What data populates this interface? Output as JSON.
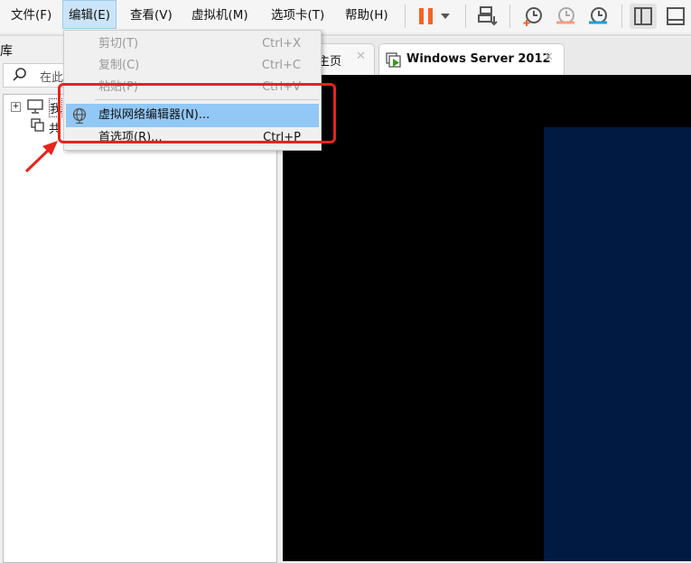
{
  "menubar": {
    "items": [
      "文件(F)",
      "编辑(E)",
      "查看(V)",
      "虚拟机(M)",
      "选项卡(T)",
      "帮助(H)"
    ]
  },
  "toolbar": {
    "icons": [
      "pause-icon",
      "dropdown-icon",
      "send-ctrl-alt-del-icon",
      "snapshot-take-icon",
      "snapshot-revert-icon",
      "snapshot-manager-icon",
      "library-view-icon",
      "thumbnail-view-icon"
    ],
    "accent": "#f26522"
  },
  "library": {
    "title": "库",
    "search_placeholder": "在此",
    "tree": [
      "我",
      "共"
    ]
  },
  "tabs": [
    {
      "label": "主页"
    },
    {
      "label": "Windows Server 2012"
    }
  ],
  "edit_menu": {
    "items": [
      {
        "label": "剪切(T)",
        "shortcut": "Ctrl+X",
        "disabled": true
      },
      {
        "label": "复制(C)",
        "shortcut": "Ctrl+C",
        "disabled": true
      },
      {
        "label": "粘贴(P)",
        "shortcut": "Ctrl+V",
        "disabled": true
      },
      {
        "label": "虚拟网络编辑器(N)...",
        "shortcut": "",
        "highlighted": true
      },
      {
        "label": "首选项(R)...",
        "shortcut": "Ctrl+P"
      }
    ]
  },
  "annotation": {
    "color": "#e8231a"
  },
  "screen": {
    "desktop_color": "#001a42"
  }
}
